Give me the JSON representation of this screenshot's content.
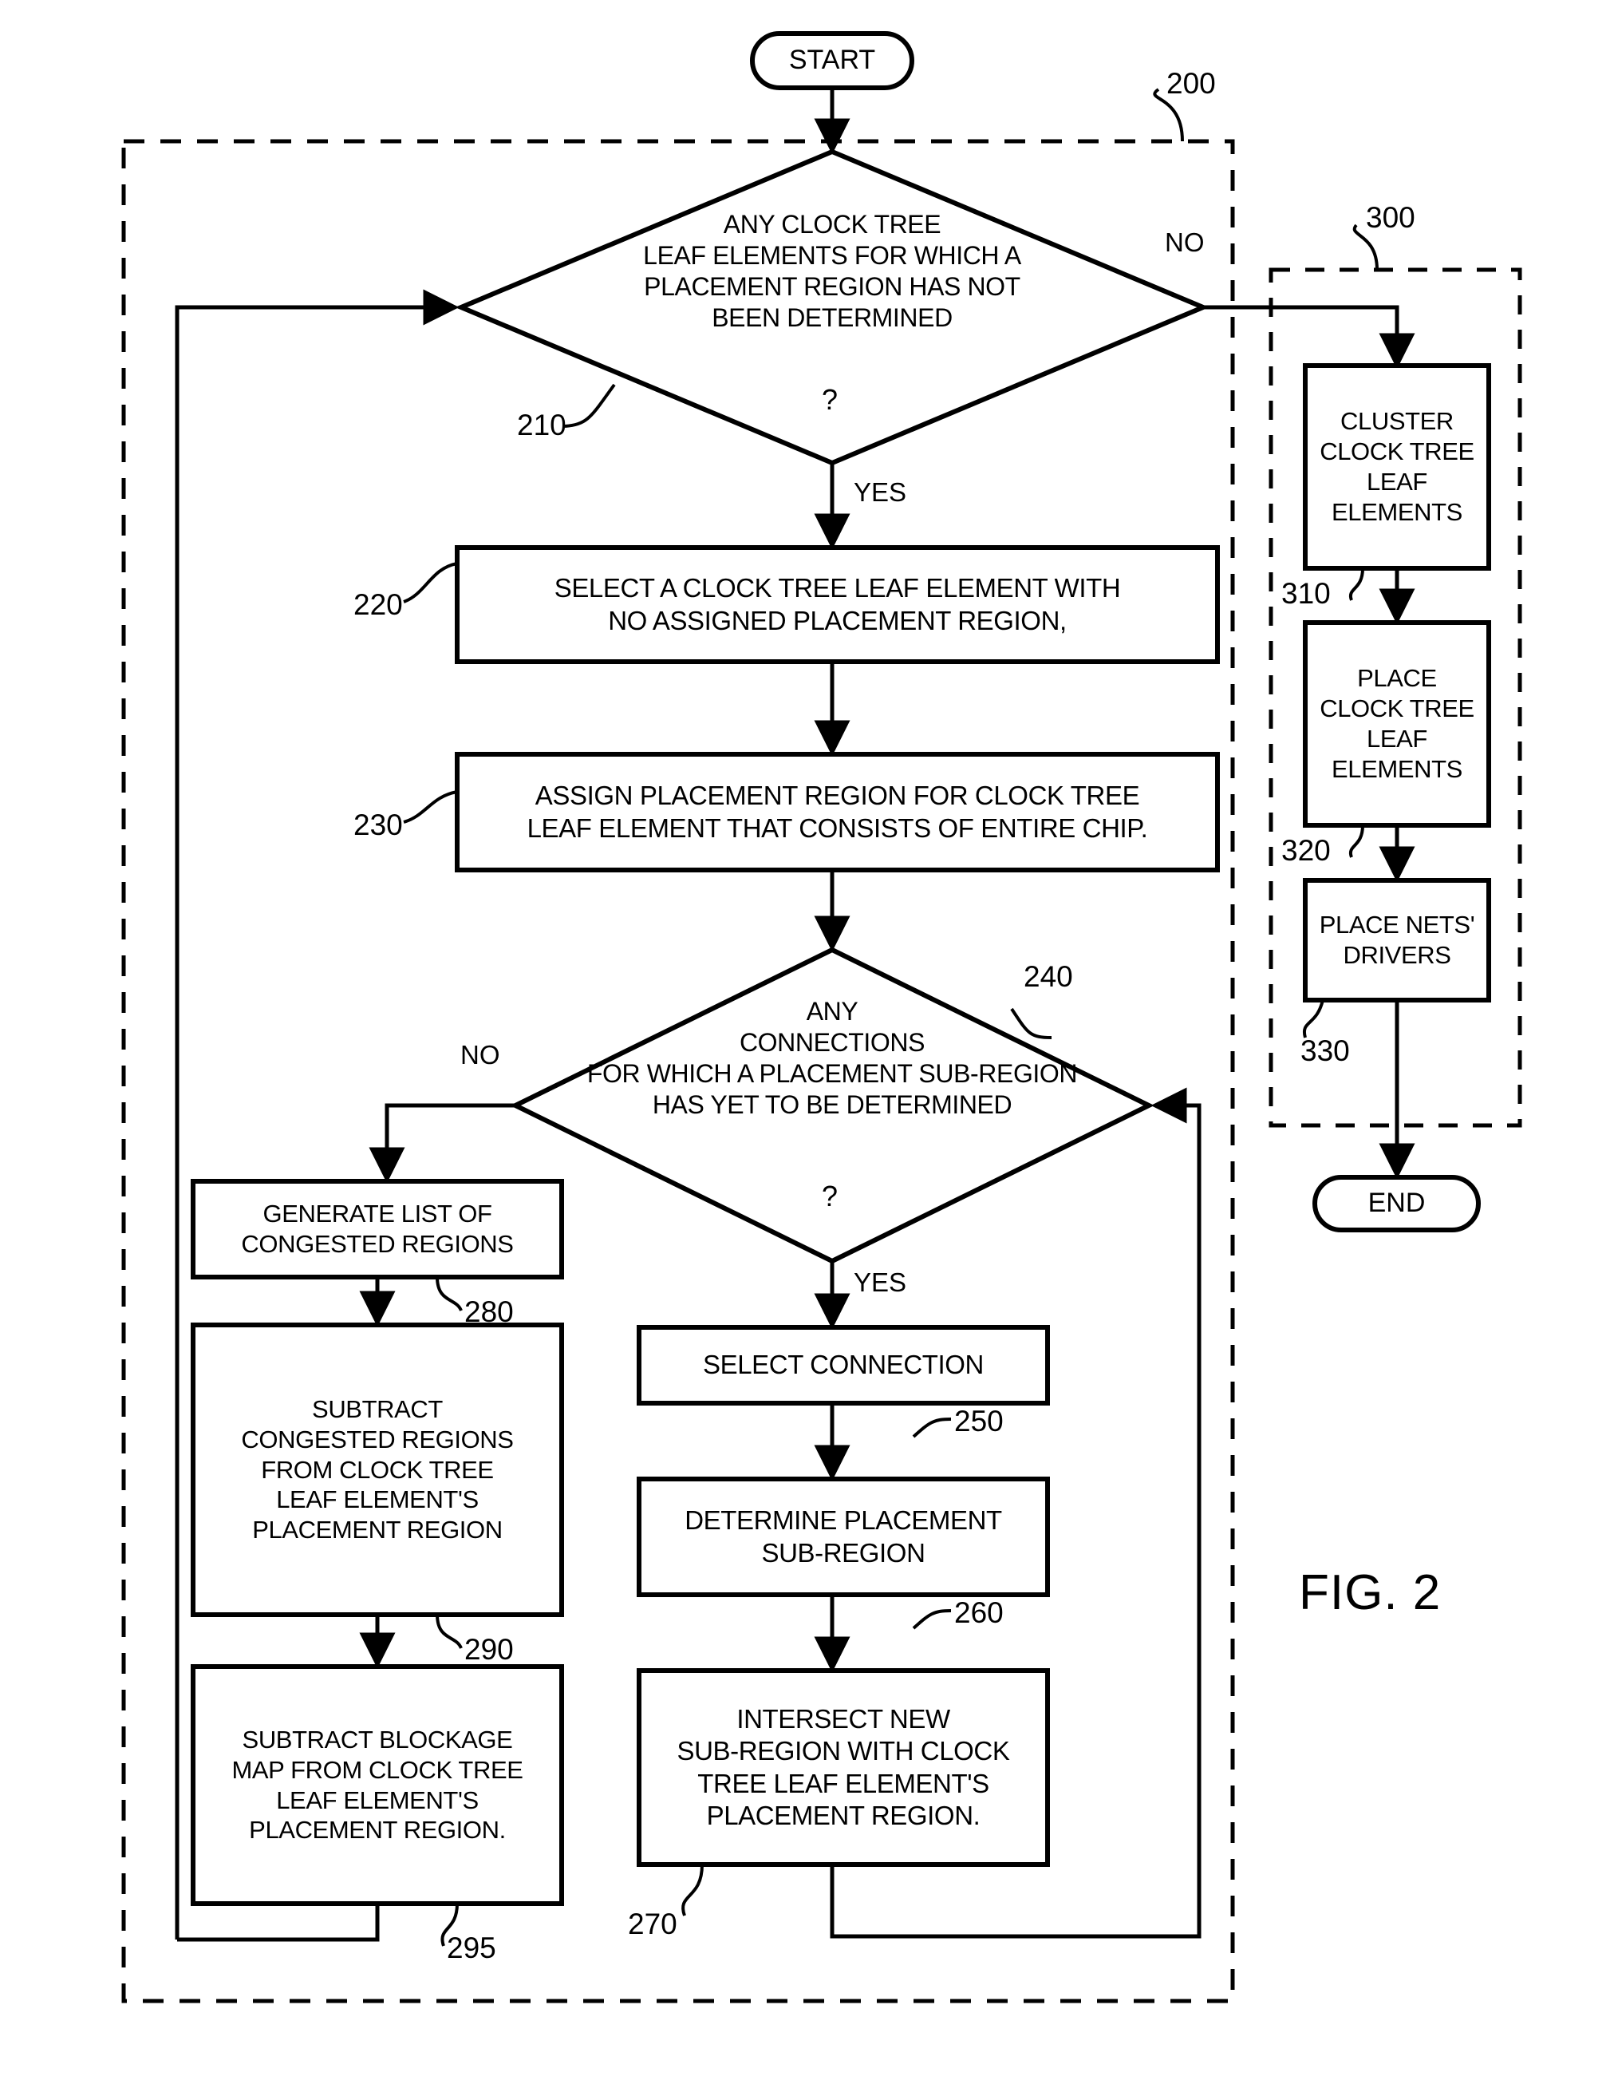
{
  "figure": {
    "label": "FIG. 2",
    "outer_group_ref": "200",
    "inner_group_ref": "300"
  },
  "terminals": {
    "start": "START",
    "end": "END"
  },
  "branch_labels": {
    "d210_no": "NO",
    "d210_yes": "YES",
    "d240_no": "NO",
    "d240_yes": "YES"
  },
  "question_marks": {
    "d210": "?",
    "d240": "?"
  },
  "nodes": [
    {
      "id": "210",
      "ref": "210",
      "shape": "decision",
      "text": "ANY CLOCK TREE\nLEAF ELEMENTS FOR WHICH A\nPLACEMENT REGION HAS NOT\nBEEN DETERMINED"
    },
    {
      "id": "220",
      "ref": "220",
      "shape": "process",
      "text": "SELECT A CLOCK TREE LEAF ELEMENT WITH\nNO ASSIGNED PLACEMENT REGION,"
    },
    {
      "id": "230",
      "ref": "230",
      "shape": "process",
      "text": "ASSIGN PLACEMENT REGION FOR CLOCK TREE\nLEAF ELEMENT THAT CONSISTS OF ENTIRE CHIP."
    },
    {
      "id": "240",
      "ref": "240",
      "shape": "decision",
      "text": "ANY\nCONNECTIONS\nFOR WHICH A PLACEMENT SUB-REGION\nHAS YET TO BE DETERMINED"
    },
    {
      "id": "250",
      "ref": "250",
      "shape": "process",
      "text": "SELECT CONNECTION"
    },
    {
      "id": "260",
      "ref": "260",
      "shape": "process",
      "text": "DETERMINE PLACEMENT\nSUB-REGION"
    },
    {
      "id": "270",
      "ref": "270",
      "shape": "process",
      "text": "INTERSECT NEW\nSUB-REGION WITH CLOCK\nTREE LEAF ELEMENT'S\nPLACEMENT REGION."
    },
    {
      "id": "280",
      "ref": "280",
      "shape": "process",
      "text": "GENERATE LIST OF\nCONGESTED REGIONS"
    },
    {
      "id": "290",
      "ref": "290",
      "shape": "process",
      "text": "SUBTRACT\nCONGESTED REGIONS\nFROM CLOCK TREE\nLEAF ELEMENT'S\nPLACEMENT REGION"
    },
    {
      "id": "295",
      "ref": "295",
      "shape": "process",
      "text": "SUBTRACT BLOCKAGE\nMAP FROM CLOCK TREE\nLEAF ELEMENT'S\nPLACEMENT REGION."
    },
    {
      "id": "310",
      "ref": "310",
      "shape": "process",
      "text": "CLUSTER\nCLOCK TREE\nLEAF\nELEMENTS"
    },
    {
      "id": "320",
      "ref": "320",
      "shape": "process",
      "text": "PLACE\nCLOCK TREE\nLEAF\nELEMENTS"
    },
    {
      "id": "330",
      "ref": "330",
      "shape": "process",
      "text": "PLACE NETS'\nDRIVERS"
    }
  ],
  "colors": {
    "stroke": "#000000",
    "background": "#ffffff",
    "text": "#000000"
  }
}
